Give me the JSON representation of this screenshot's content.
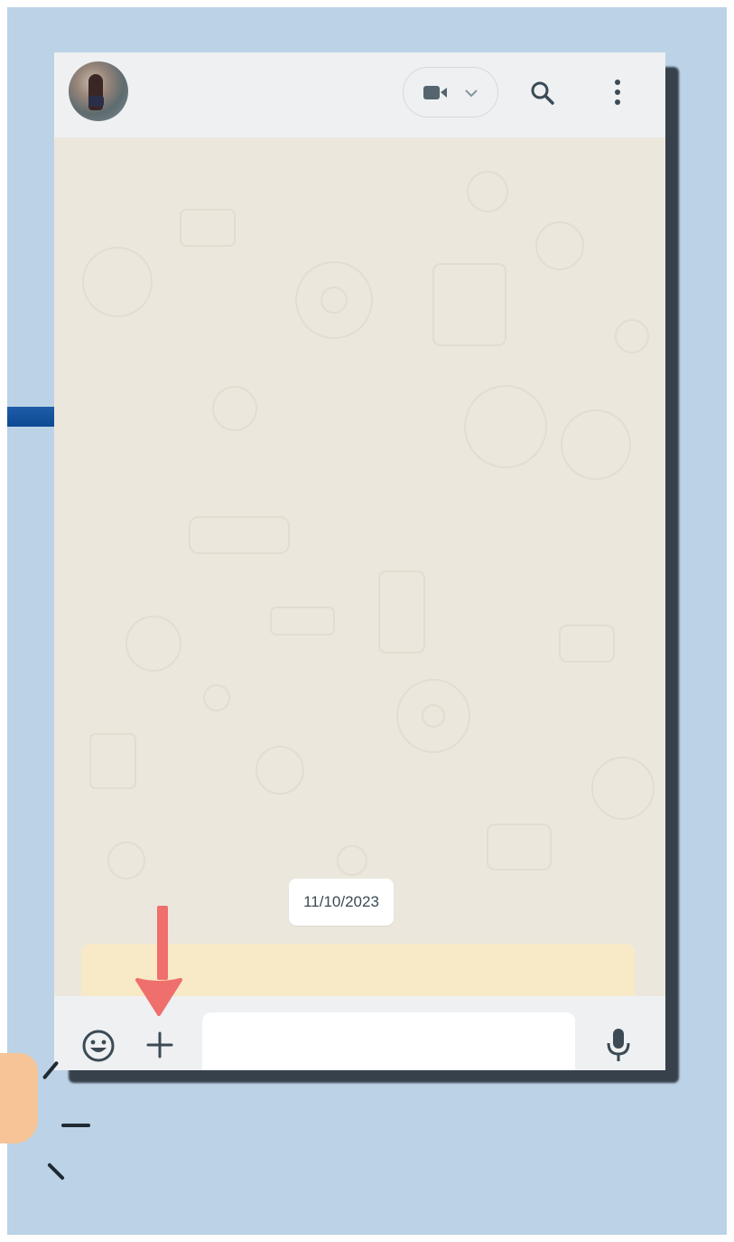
{
  "header": {
    "avatar_alt": "contact-photo",
    "video_call_icon": "video-camera-icon",
    "dropdown_icon": "chevron-down-icon",
    "search_icon": "search-icon",
    "menu_icon": "more-vertical-icon"
  },
  "chat": {
    "date_chip": "11/10/2023",
    "highlight_box_color": "#f8e9c7"
  },
  "footer": {
    "emoji_icon": "smiley-icon",
    "attach_icon": "plus-icon",
    "message_input_value": "",
    "mic_icon": "microphone-icon"
  },
  "annotation": {
    "arrow_color": "#ef6f6c",
    "arrow_target": "plus-icon"
  },
  "colors": {
    "background": "#bcd2e6",
    "header": "#eef0f2",
    "chat_wallpaper": "#ece7dd"
  }
}
